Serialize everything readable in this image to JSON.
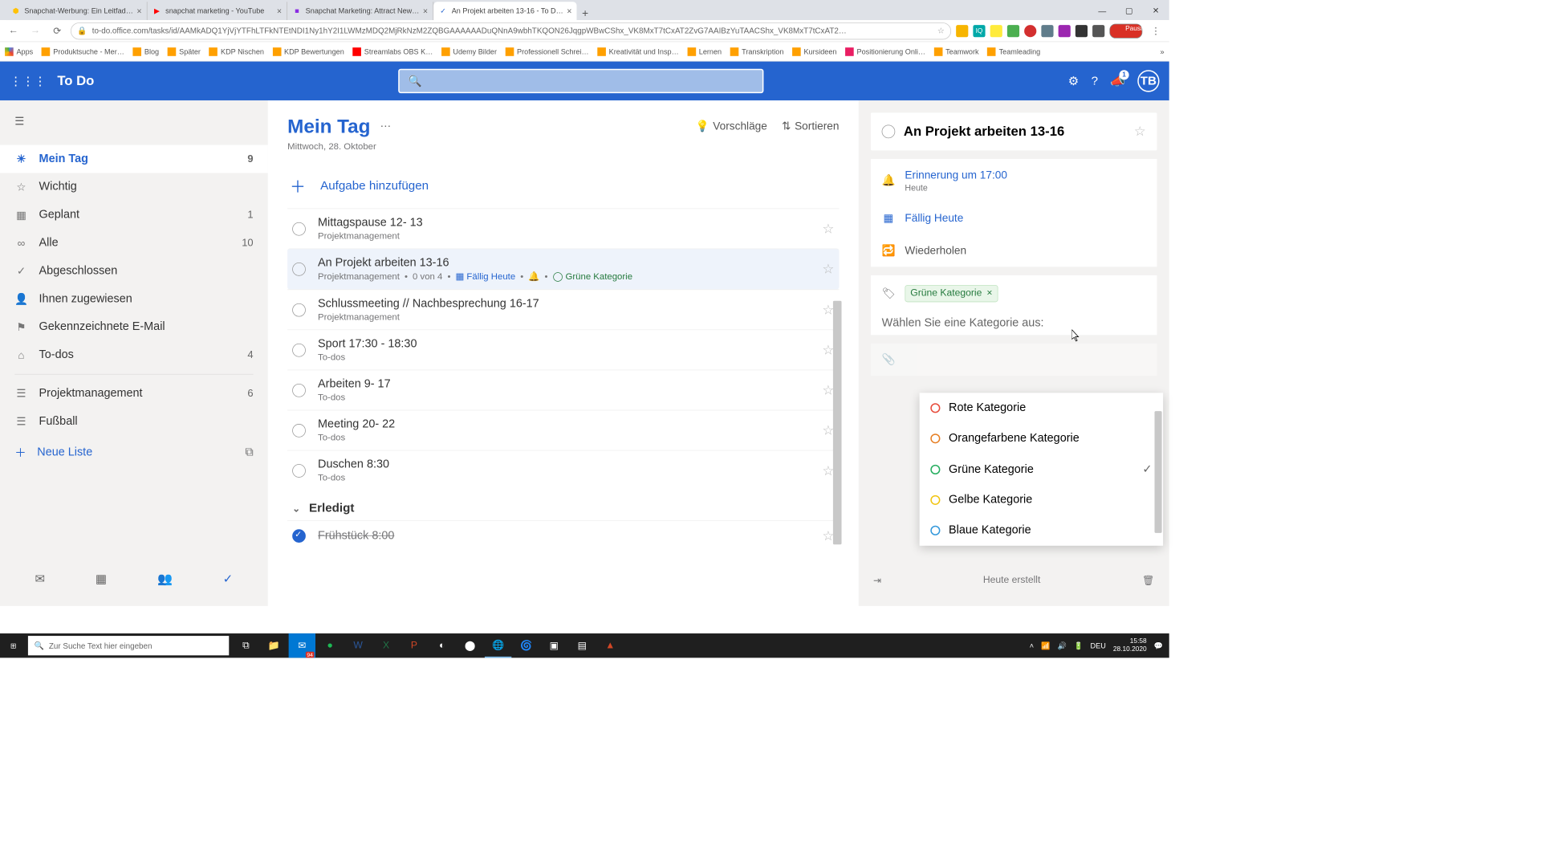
{
  "browser": {
    "tabs": [
      {
        "label": "Snapchat-Werbung: Ein Leitfad…",
        "favicon": "⬢",
        "favColor": "#ffc107"
      },
      {
        "label": "snapchat marketing - YouTube",
        "favicon": "▶",
        "favColor": "#ff0000"
      },
      {
        "label": "Snapchat Marketing: Attract New…",
        "favicon": "■",
        "favColor": "#8a2be2"
      },
      {
        "label": "An Projekt arbeiten 13-16 - To D…",
        "favicon": "✓",
        "favColor": "#2564cf",
        "active": true
      }
    ],
    "url": "to-do.office.com/tasks/id/AAMkADQ1YjVjYTFhLTFkNTEtNDI1Ny1hY2I1LWMzMDQ2MjRkNzM2ZQBGAAAAAAD­uQNnA9wbhTKQON26JqgpWBwCShx_VK8MxT7tCxAT2ZvG7AAIBzYuTAACShx_VK8MxT7tCxAT2…",
    "ext_pause": "Pausiert",
    "bookmarks": [
      "Apps",
      "Produktsuche - Mer…",
      "Blog",
      "Später",
      "KDP Nischen",
      "KDP Bewertungen",
      "Streamlabs OBS K…",
      "Udemy Bilder",
      "Professionell Schrei…",
      "Kreativität und Insp…",
      "Lernen",
      "Transkription",
      "Kursideen",
      "Positionierung Onli…",
      "Teamwork",
      "Teamleading"
    ]
  },
  "header": {
    "app": "To Do",
    "notif_count": "1",
    "avatar": "TB"
  },
  "sidebar": {
    "items": [
      {
        "icon": "☀",
        "label": "Mein Tag",
        "count": "9",
        "active": true
      },
      {
        "icon": "☆",
        "label": "Wichtig",
        "count": ""
      },
      {
        "icon": "▦",
        "label": "Geplant",
        "count": "1"
      },
      {
        "icon": "∞",
        "label": "Alle",
        "count": "10"
      },
      {
        "icon": "✓",
        "label": "Abgeschlossen",
        "count": ""
      },
      {
        "icon": "👤",
        "label": "Ihnen zugewiesen",
        "count": ""
      },
      {
        "icon": "✉",
        "label": "Gekennzeichnete E-Mail",
        "count": ""
      },
      {
        "icon": "⌂",
        "label": "To-dos",
        "count": "4"
      }
    ],
    "lists": [
      {
        "icon": "☰",
        "label": "Projektmanagement",
        "count": "6"
      },
      {
        "icon": "☰",
        "label": "Fußball",
        "count": ""
      }
    ],
    "new_list": "Neue Liste"
  },
  "content": {
    "title": "Mein Tag",
    "date": "Mittwoch, 28. Oktober",
    "suggest": "Vorschläge",
    "sort": "Sortieren",
    "add_task": "Aufgabe hinzufügen",
    "tasks": [
      {
        "title": "Mittagspause 12- 13",
        "meta": "Projektmanagement"
      },
      {
        "title": "An Projekt arbeiten 13-16",
        "meta": "Projektmanagement",
        "steps": "0 von 4",
        "due": "Fällig Heute",
        "bell": true,
        "cat": "Grüne Kategorie",
        "selected": true
      },
      {
        "title": "Schlussmeeting // Nachbesprechung 16-17",
        "meta": "Projektmanagement"
      },
      {
        "title": "Sport 17:30 - 18:30",
        "meta": "To-dos"
      },
      {
        "title": "Arbeiten 9- 17",
        "meta": "To-dos"
      },
      {
        "title": "Meeting 20- 22",
        "meta": "To-dos"
      },
      {
        "title": "Duschen 8:30",
        "meta": "To-dos"
      }
    ],
    "done_header": "Erledigt",
    "done_tasks": [
      {
        "title": "Frühstück 8:00"
      }
    ]
  },
  "detail": {
    "title": "An Projekt arbeiten 13-16",
    "reminder": "Erinnerung um 17:00",
    "reminder_sub": "Heute",
    "due": "Fällig Heute",
    "repeat": "Wiederholen",
    "chip": "Grüne Kategorie",
    "cat_prompt": "Wählen Sie eine Kategorie aus:",
    "categories": [
      {
        "label": "Rote Kategorie",
        "color": "#e74c3c"
      },
      {
        "label": "Orangefarbene Kategorie",
        "color": "#e67e22"
      },
      {
        "label": "Grüne Kategorie",
        "color": "#27ae60",
        "checked": true
      },
      {
        "label": "Gelbe Kategorie",
        "color": "#f1c40f"
      },
      {
        "label": "Blaue Kategorie",
        "color": "#3498db"
      }
    ],
    "created": "Heute erstellt"
  },
  "taskbar": {
    "search": "Zur Suche Text hier eingeben",
    "time": "15:58",
    "date": "28.10.2020",
    "lang": "DEU",
    "mail_count": "94"
  }
}
